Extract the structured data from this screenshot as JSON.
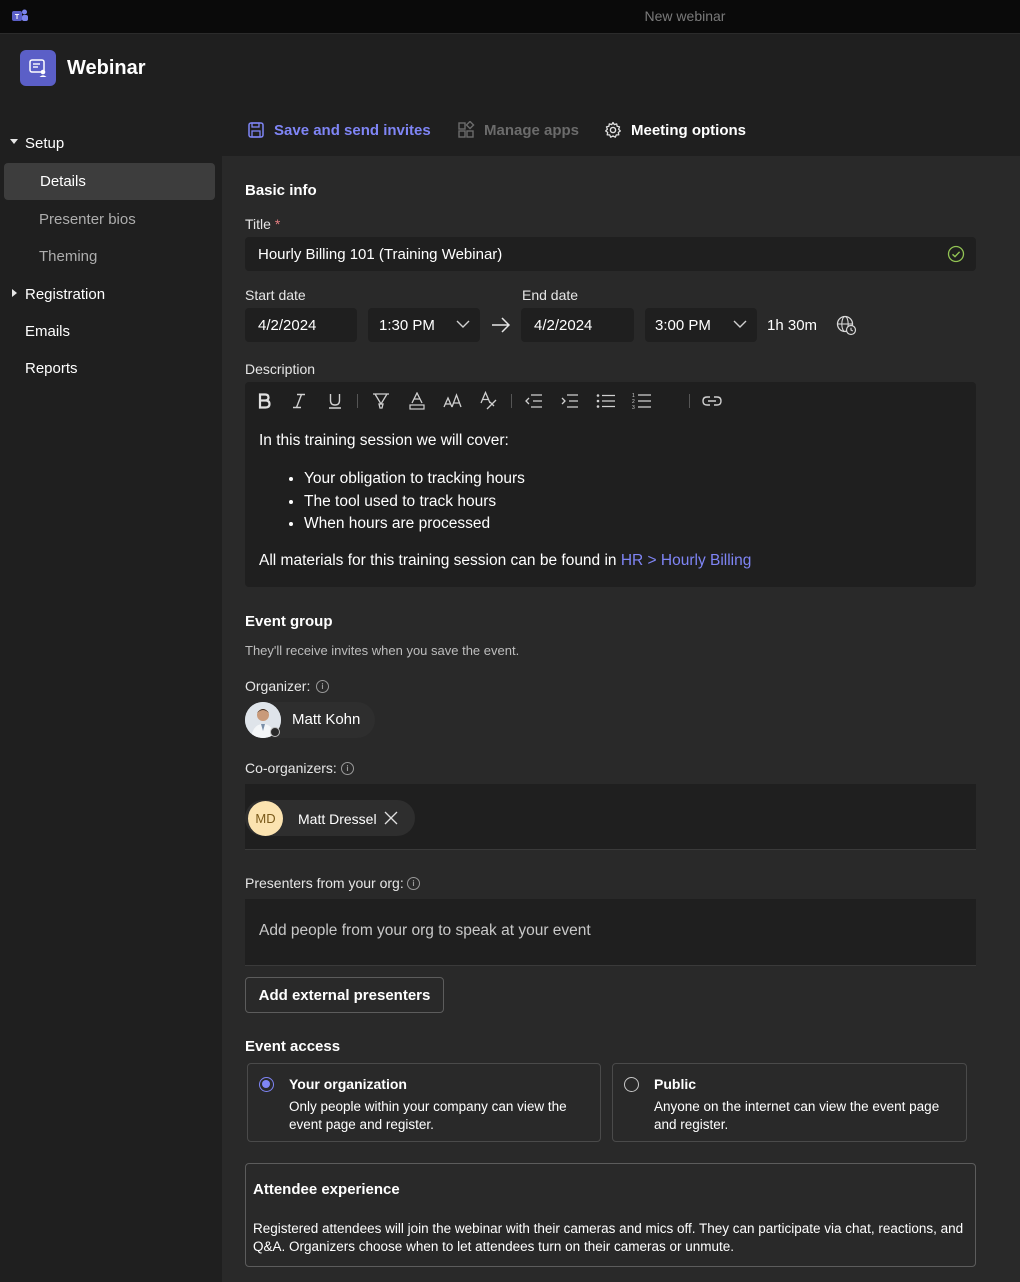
{
  "window": {
    "title": "New webinar"
  },
  "app": {
    "name": "Webinar"
  },
  "sidebar": {
    "items": [
      {
        "label": "Setup"
      },
      {
        "label": "Details"
      },
      {
        "label": "Presenter bios"
      },
      {
        "label": "Theming"
      },
      {
        "label": "Registration"
      },
      {
        "label": "Emails"
      },
      {
        "label": "Reports"
      }
    ]
  },
  "toolbar": {
    "save_label": "Save and send invites",
    "manage_apps_label": "Manage apps",
    "meeting_options_label": "Meeting options"
  },
  "basic_info": {
    "heading": "Basic info",
    "title_label": "Title",
    "required_mark": "*",
    "title_value": "Hourly Billing 101 (Training Webinar)",
    "start_label": "Start date",
    "start_date": "4/2/2024",
    "start_time": "1:30 PM",
    "end_label": "End date",
    "end_date": "4/2/2024",
    "end_time": "3:00 PM",
    "duration": "1h 30m"
  },
  "description": {
    "label": "Description",
    "intro": "In this training session we will cover:",
    "bullets": [
      "Your obligation to tracking hours",
      "The tool used to track hours",
      "When hours are processed"
    ],
    "footer_prefix": "All materials for this training session can be found in",
    "link_text": "HR > Hourly Billing"
  },
  "event_group": {
    "heading": "Event group",
    "subtext": "They'll receive invites when you save the event.",
    "organizer_label": "Organizer:",
    "organizer_name": "Matt Kohn",
    "coorganizers_label": "Co-organizers:",
    "coorganizer_initials": "MD",
    "coorganizer_name": "Matt Dressel",
    "presenters_label": "Presenters from your org:",
    "presenters_placeholder": "Add people from your org to speak at your event",
    "add_external_label": "Add external presenters"
  },
  "event_access": {
    "heading": "Event access",
    "options": [
      {
        "title": "Your organization",
        "desc": "Only people within your company can view the event page and register.",
        "selected": true
      },
      {
        "title": "Public",
        "desc": "Anyone on the internet can view the event page and register.",
        "selected": false
      }
    ]
  },
  "attendee_experience": {
    "heading": "Attendee experience",
    "text": "Registered attendees will join the webinar with their cameras and mics off. They can participate via chat, reactions, and Q&A. Organizers choose when to let attendees turn on their cameras or unmute."
  },
  "colors": {
    "accent": "#7f85f5",
    "brand": "#5b5fc7",
    "success": "#92c353"
  }
}
